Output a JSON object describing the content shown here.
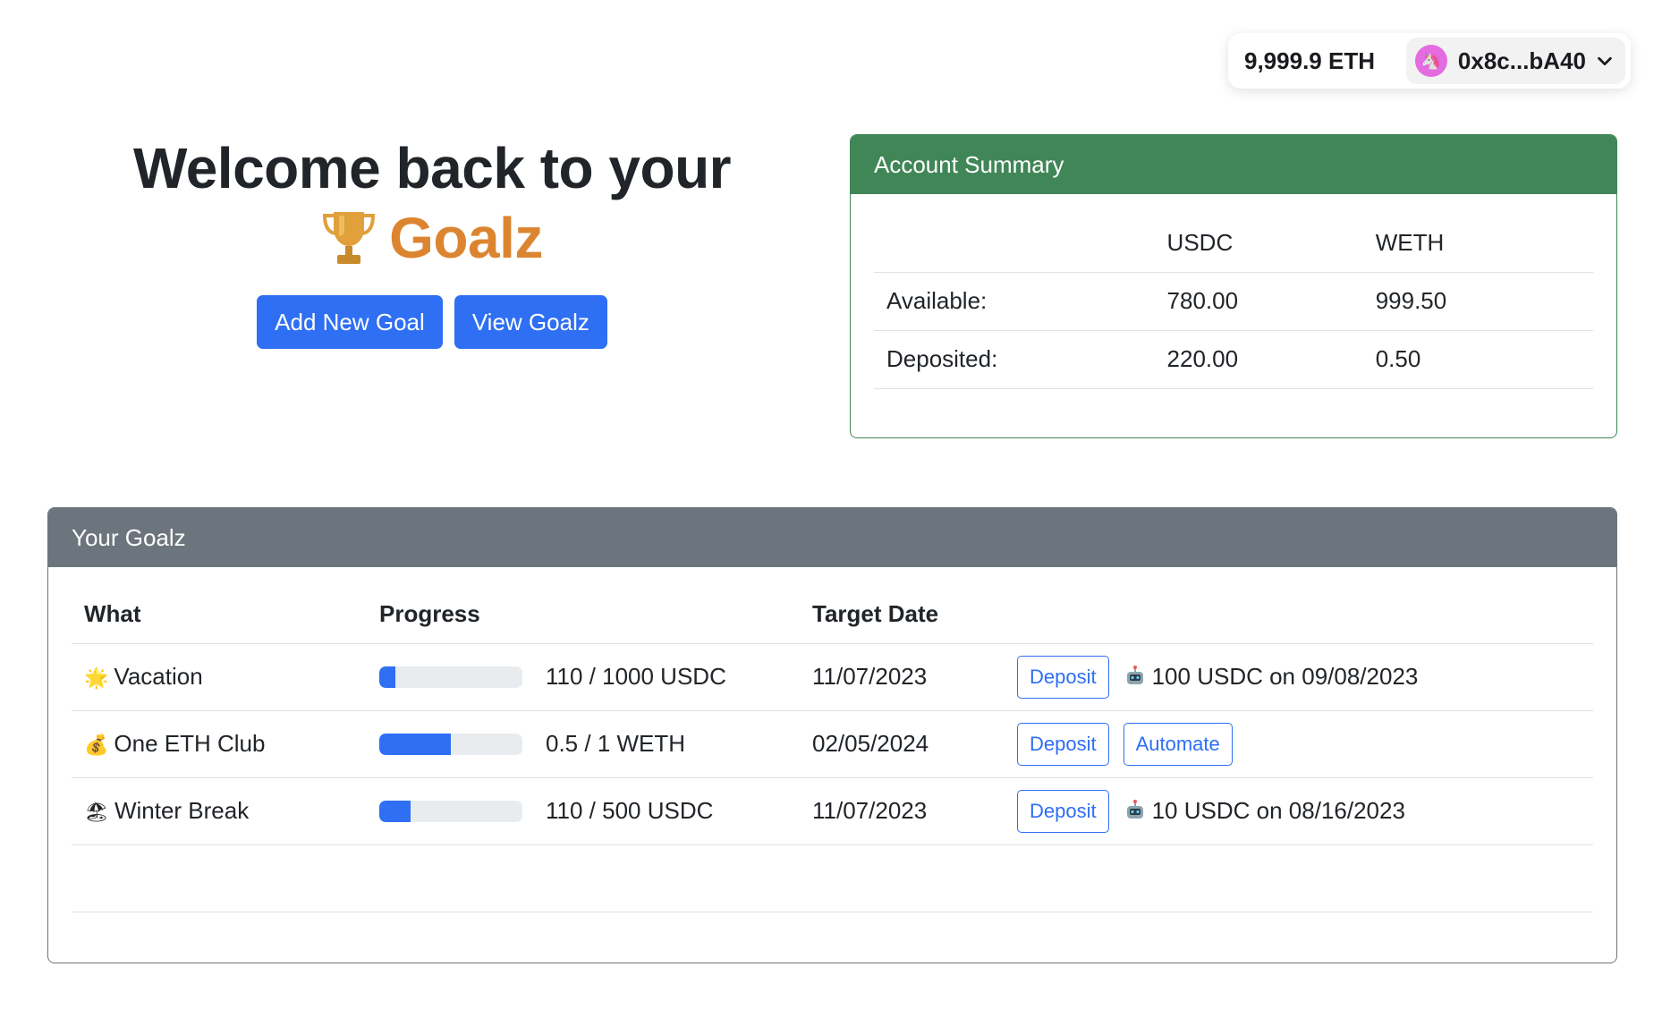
{
  "wallet": {
    "balance": "9,999.9 ETH",
    "address": "0x8c...bA40",
    "avatar_icon": "unicorn-icon",
    "avatar_color": "#e46be0"
  },
  "hero": {
    "title": "Welcome back to your",
    "brand_icon": "trophy-icon",
    "brand": "Goalz",
    "brand_color": "#dc8530",
    "add_goal_label": "Add New Goal",
    "view_goals_label": "View Goalz"
  },
  "summary": {
    "title": "Account Summary",
    "header_color": "#408656",
    "columns": [
      "",
      "USDC",
      "WETH"
    ],
    "rows": [
      {
        "label": "Available:",
        "usdc": "780.00",
        "weth": "999.50"
      },
      {
        "label": "Deposited:",
        "usdc": "220.00",
        "weth": "0.50"
      }
    ]
  },
  "goals": {
    "title": "Your Goalz",
    "header_color": "#6c757d",
    "columns": [
      "What",
      "Progress",
      "Target Date",
      ""
    ],
    "rows": [
      {
        "emoji": "🌟",
        "what": "Vacation",
        "progress_fraction": 0.11,
        "progress_text": "110 / 1000 USDC",
        "target_date": "11/07/2023",
        "deposit_label": "Deposit",
        "automation": "100 USDC on 09/08/2023",
        "automate_label": ""
      },
      {
        "emoji": "💰",
        "what": "One ETH Club",
        "progress_fraction": 0.5,
        "progress_text": "0.5 / 1 WETH",
        "target_date": "02/05/2024",
        "deposit_label": "Deposit",
        "automation": "",
        "automate_label": "Automate"
      },
      {
        "emoji": "🏖",
        "what": "Winter Break",
        "progress_fraction": 0.22,
        "progress_text": "110 / 500 USDC",
        "target_date": "11/07/2023",
        "deposit_label": "Deposit",
        "automation": "10 USDC on 08/16/2023",
        "automate_label": ""
      }
    ]
  },
  "accent_color": "#2e6ff3"
}
